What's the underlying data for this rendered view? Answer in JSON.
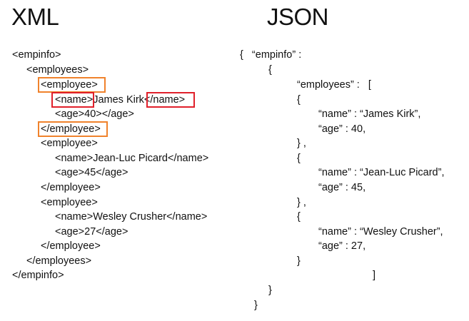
{
  "xml": {
    "heading": "XML",
    "lines": [
      "<empinfo>",
      "<employees>",
      "<employee>",
      "<name>James Kirk</name>",
      "<age>40></age>",
      "</employee>",
      "<employee>",
      "<name>Jean-Luc Picard</name>",
      "<age>45</age>",
      "</employee>",
      "<employee>",
      "<name>Wesley Crusher</name>",
      "<age>27</age>",
      "</employee>",
      "</employees>",
      "</empinfo>"
    ],
    "highlight_colors": {
      "employee_tag": "#f0822c",
      "name_tag": "#e0202b"
    }
  },
  "json": {
    "heading": "JSON",
    "lines": [
      "{   “empinfo” :",
      "{",
      "“employees” :   [",
      "{",
      "“name” : “James Kirk”,",
      "“age” : 40,",
      "} ,",
      "{",
      "“name” : “Jean-Luc Picard”,",
      "“age” : 45,",
      "} ,",
      "{",
      "“name” : “Wesley Crusher”,",
      "“age” : 27,",
      "}",
      "]",
      "}",
      "}"
    ]
  }
}
